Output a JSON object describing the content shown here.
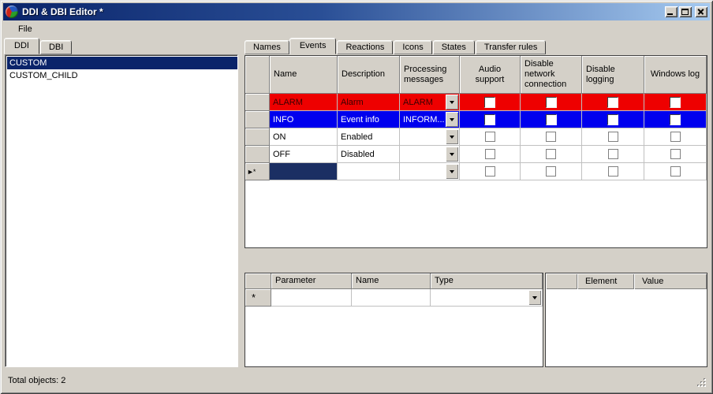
{
  "window": {
    "title": "DDI & DBI Editor *"
  },
  "menu": {
    "items": [
      "File"
    ]
  },
  "colors": {
    "face": "#d4d0c8",
    "titlebar_from": "#0a246a",
    "titlebar_to": "#a6caf0",
    "titlebar_gradient": "linear-gradient(90deg, #0a246a 0%, #2a4f96 45%, #a6caf0 100%)",
    "alarm_row_bg": "#ee0000",
    "alarm_row_fg": "#3a0000",
    "info_row_bg": "#0000ee",
    "info_row_fg": "#ffffff",
    "selection": "#0a246a",
    "new_cell_selection": "#1b2f63"
  },
  "left_panel": {
    "tabs": [
      {
        "label": "DDI",
        "active": true
      },
      {
        "label": "DBI",
        "active": false
      }
    ],
    "list": [
      {
        "label": "CUSTOM",
        "selected": true
      },
      {
        "label": "CUSTOM_CHILD",
        "selected": false
      }
    ]
  },
  "right_panel": {
    "tabs": [
      {
        "label": "Names",
        "active": false
      },
      {
        "label": "Events",
        "active": true
      },
      {
        "label": "Reactions",
        "active": false
      },
      {
        "label": "Icons",
        "active": false
      },
      {
        "label": "States",
        "active": false
      },
      {
        "label": "Transfer rules",
        "active": false
      }
    ]
  },
  "events_grid": {
    "columns": [
      "Name",
      "Description",
      "Processing messages",
      "Audio support",
      "Disable network connection",
      "Disable logging",
      "Windows log"
    ],
    "new_row_marker": "►*",
    "rows": [
      {
        "name": "ALARM",
        "description": "Alarm",
        "processing": "ALARM",
        "audio_support": false,
        "disable_network": false,
        "disable_logging": false,
        "windows_log": false
      },
      {
        "name": "INFO",
        "description": "Event info",
        "processing": "INFORM...",
        "audio_support": false,
        "disable_network": false,
        "disable_logging": false,
        "windows_log": false
      },
      {
        "name": "ON",
        "description": "Enabled",
        "processing": "",
        "audio_support": false,
        "disable_network": false,
        "disable_logging": false,
        "windows_log": false
      },
      {
        "name": "OFF",
        "description": "Disabled",
        "processing": "",
        "audio_support": false,
        "disable_network": false,
        "disable_logging": false,
        "windows_log": false
      }
    ]
  },
  "params_grid": {
    "columns": [
      "Parameter",
      "Name",
      "Type"
    ],
    "new_row_marker": "*"
  },
  "elements_list": {
    "columns": [
      "Element",
      "Value"
    ]
  },
  "status_bar": {
    "text": "Total objects: 2"
  }
}
